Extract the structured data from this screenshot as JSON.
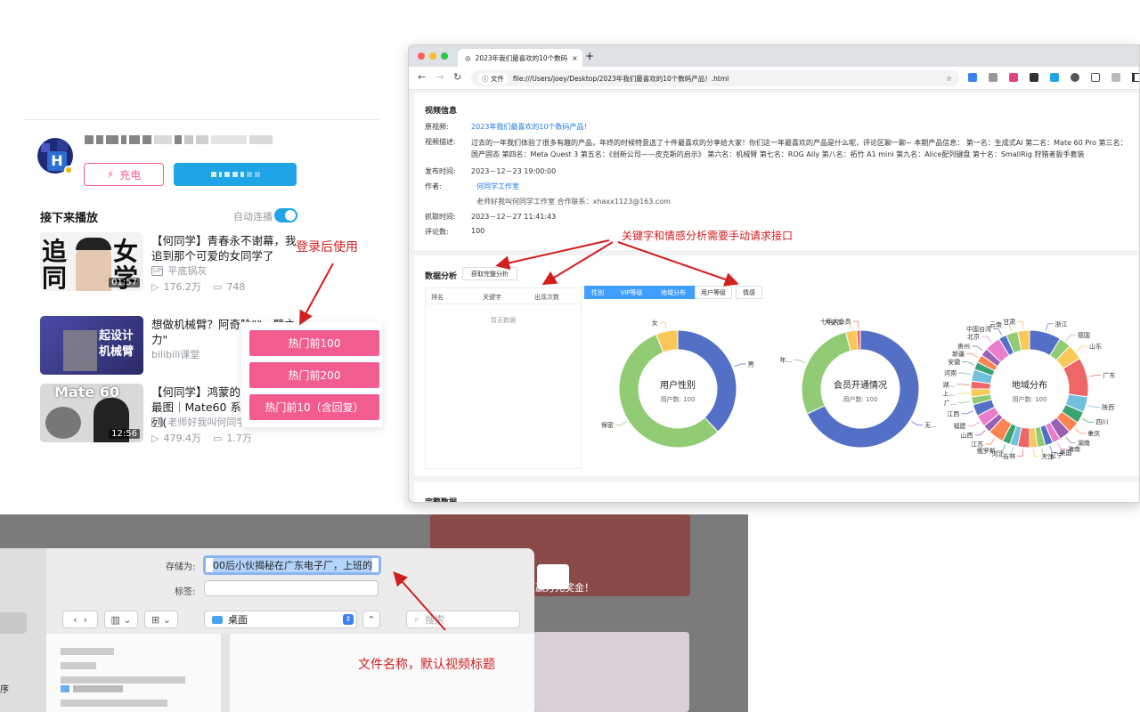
{
  "bili": {
    "charge_label": "充电",
    "next_play": "接下来播放",
    "autoplay": "自动连播",
    "videos": [
      {
        "title": "【何同学】青春永不谢幕，我追到那个可爱的女同学了",
        "up": "平底锅灰",
        "views": "176.2万",
        "danmaku": "748",
        "duration": "01:57",
        "thumb_text1": "追",
        "thumb_text2": "女",
        "thumb_text3": "同",
        "thumb_text4": "学"
      },
      {
        "title": "想做机械臂？阿奇阶\"\"，臂之力\"",
        "up": "bilibili课堂",
        "thumb_text": "起设计 机械臂"
      },
      {
        "title": "【何同学】鸿蒙的最图｜Mate60 系列(",
        "up": "老师好我叫何同学",
        "views": "479.4万",
        "danmaku": "1.7万",
        "duration": "12:56",
        "thumb_text": "Mate 60"
      }
    ],
    "pink_buttons": [
      "热门前100",
      "热门前200",
      "热门前10（含回复）"
    ],
    "note_login": "登录后使用"
  },
  "browser": {
    "tab_title": "2023年我们最喜欢的10个数码",
    "new_tab": "+",
    "url_prefix": "文件",
    "url": "file:///Users/joey/Desktop/2023年我们最喜欢的10个数码产品！.html",
    "video_info": {
      "heading": "视频信息",
      "fields": [
        {
          "label": "原视频:",
          "value": "2023年我们最喜欢的10个数码产品！"
        },
        {
          "label": "视频描述:",
          "value": "过去的一年我们体验了很多有趣的产品，年终的时候特意选了十件最喜欢的分享给大家！你们这一年最喜欢的产品是什么呢，评论区聊一聊~ 本期产品信息： 第一名：生成式AI 第二名：Mate 60 Pro 第三名：国产固态 第四名：Meta Quest 3 第五名：《创新公司——皮克斯的启示》 第六名：机械臂 第七名：ROG Ally 第八名：拓竹 A1 mini 第九名：Alice配列键盘 第十名：SmallRig 狩猎者扳手套装"
        },
        {
          "label": "发布时间:",
          "value": "2023－12－23 19:00:00"
        },
        {
          "label": "作者:",
          "value": "何同学工作室"
        },
        {
          "label": "",
          "value": "老师好我叫何同学工作室 合作联系：xhaxx1123@163.com"
        },
        {
          "label": "抓取时间:",
          "value": "2023－12－27 11:41:43"
        },
        {
          "label": "评论数:",
          "value": "100"
        }
      ]
    },
    "analysis": {
      "heading": "数据分析",
      "fetch_button": "获取完整分析",
      "table_headers": [
        "排名",
        "关键字",
        "出现次数"
      ],
      "empty": "暂无数据",
      "chips": [
        "性别",
        "VIP等级",
        "地域分布",
        "用户等级",
        "情感"
      ],
      "next_section": "完整数据"
    },
    "note_api": "关键字和情感分析需要手动请求接口"
  },
  "chart_data": [
    {
      "type": "pie",
      "title": "用户性别",
      "subtitle": "用户数: 100",
      "categories": [
        "男",
        "保密",
        "女"
      ],
      "values": [
        38,
        56,
        6
      ],
      "colors": [
        "#5470c6",
        "#91cc75",
        "#fac858"
      ]
    },
    {
      "type": "pie",
      "title": "会员开通情况",
      "subtitle": "用户数: 100",
      "categories": [
        "无...",
        "年...",
        "大会员",
        "十年大会员"
      ],
      "values": [
        68,
        28,
        3,
        1
      ],
      "colors": [
        "#5470c6",
        "#91cc75",
        "#fac858",
        "#ee6666"
      ]
    },
    {
      "type": "pie",
      "title": "地域分布",
      "subtitle": "用户数: 100",
      "categories": [
        "浙江",
        "德国",
        "山东",
        "广东",
        "陕西",
        "四川",
        "重庆",
        "湖南",
        "海南",
        "美国",
        "辽宁",
        "天津",
        "吉林",
        "河北",
        "俄罗斯",
        "江苏",
        "山西",
        "福建",
        "江西",
        "广...",
        "上...",
        "湖...",
        "河南",
        "安徽",
        "新疆",
        "贵州",
        "北京",
        "中国台湾",
        "云南",
        "甘肃"
      ],
      "values": [
        8,
        3,
        4,
        10,
        4,
        3,
        3,
        3,
        2,
        2,
        2,
        2,
        3,
        2,
        2,
        4,
        2,
        3,
        3,
        2,
        2,
        2,
        3,
        2,
        2,
        2,
        4,
        2,
        3,
        3
      ]
    }
  ],
  "dialog": {
    "save_as_label": "存储为:",
    "save_as_value": "00后小伙揭秘在广东电子厂，上班的",
    "tags_label": "标签:",
    "location": "桌面",
    "search_placeholder": "搜索",
    "sidebar_partial": "序",
    "note_filename": "文件名称，默认视频标题",
    "promo_text": "赢万元奖金！"
  }
}
